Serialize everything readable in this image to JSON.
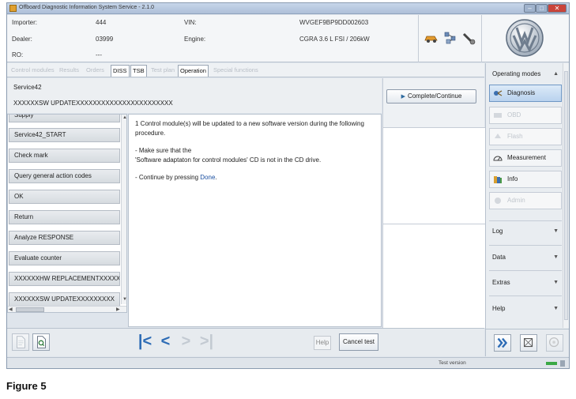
{
  "window": {
    "title": "Offboard Diagnostic Information System Service - 2.1.0"
  },
  "info": {
    "importer_label": "Importer:",
    "importer_value": "444",
    "dealer_label": "Dealer:",
    "dealer_value": "03999",
    "ro_label": "RO:",
    "ro_value": "---",
    "vin_label": "VIN:",
    "vin_value": "WVGEF9BP9DD002603",
    "engine_label": "Engine:",
    "engine_value": "CGRA 3.6 L FSI / 206kW"
  },
  "tabs": [
    {
      "label": "Control modules",
      "active": false,
      "enabled": false
    },
    {
      "label": "Results",
      "active": false,
      "enabled": false
    },
    {
      "label": "Orders",
      "active": false,
      "enabled": false
    },
    {
      "label": "DISS",
      "active": false,
      "enabled": true
    },
    {
      "label": "TSB",
      "active": false,
      "enabled": true
    },
    {
      "label": "Test plan",
      "active": false,
      "enabled": false
    },
    {
      "label": "Operation",
      "active": true,
      "enabled": true
    },
    {
      "label": "Special functions",
      "active": false,
      "enabled": false
    }
  ],
  "header": {
    "title": "Service42",
    "subtitle": "XXXXXXSW UPDATEXXXXXXXXXXXXXXXXXXXXXXX"
  },
  "complete_button": "Complete/Continue",
  "left_list": [
    "Supply",
    "Service42_START",
    "Check mark",
    "Query general action codes",
    "OK",
    "Return",
    "Analyze RESPONSE",
    "Evaluate counter",
    "XXXXXXHW REPLACEMENTXXXXX",
    "XXXXXXSW UPDATEXXXXXXXXX"
  ],
  "instructions": {
    "line1": "1  Control module(s) will be updated to a new software version during the following",
    "line2": "procedure.",
    "line3": "- Make sure that the",
    "line4": "'Software adaptaton for control modules' CD is not in the CD drive.",
    "line5_prefix": "- Continue by pressing ",
    "line5_link": "Done",
    "line5_suffix": "."
  },
  "bottom": {
    "help_label": "Help",
    "cancel_label": "Cancel test"
  },
  "right_panel": {
    "operating_modes": "Operating modes",
    "buttons": [
      {
        "label": "Diagnosis",
        "state": "selected"
      },
      {
        "label": "OBD",
        "state": "disabled"
      },
      {
        "label": "Flash",
        "state": "disabled"
      },
      {
        "label": "Measurement",
        "state": "enabled"
      },
      {
        "label": "Info",
        "state": "enabled"
      },
      {
        "label": "Admin",
        "state": "disabled"
      }
    ],
    "sections": [
      "Log",
      "Data",
      "Extras",
      "Help"
    ]
  },
  "status": {
    "text": "Test version"
  },
  "caption": "Figure 5",
  "colors": {
    "accent_blue": "#1a4fa0",
    "nav_blue": "#2c6bb5",
    "status_green": "#3aa845"
  }
}
